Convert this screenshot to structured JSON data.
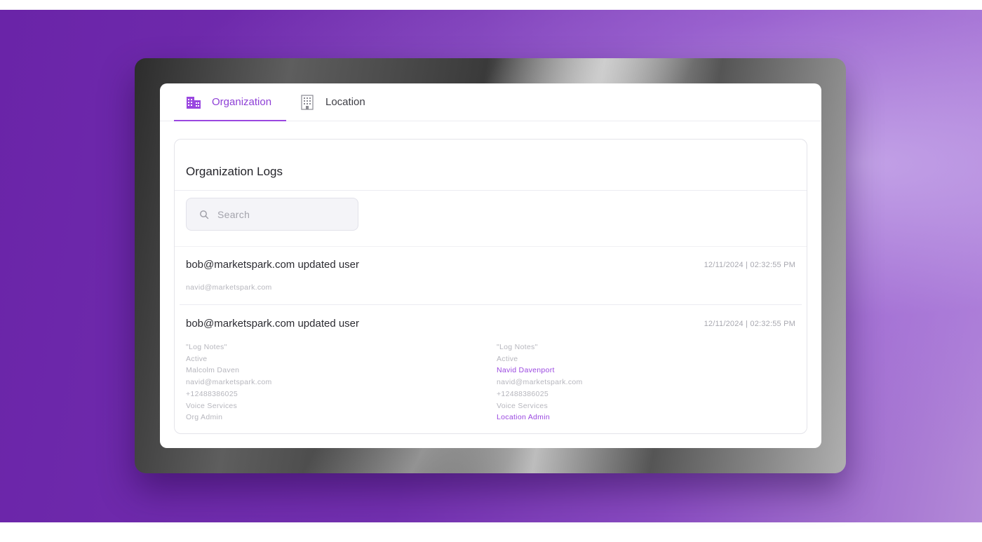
{
  "tabs": {
    "organization": {
      "label": "Organization",
      "icon": "building-icon",
      "active": true
    },
    "location": {
      "label": "Location",
      "icon": "office-building-icon",
      "active": false
    }
  },
  "logs": {
    "title": "Organization Logs",
    "search": {
      "placeholder": "Search",
      "value": ""
    },
    "entries": [
      {
        "title": "bob@marketspark.com updated user",
        "timestamp": "12/11/2024 | 02:32:55 PM",
        "subtitle": "navid@marketspark.com"
      },
      {
        "title": "bob@marketspark.com updated user",
        "timestamp": "12/11/2024 | 02:32:55 PM",
        "before": [
          "\"Log Notes\"",
          "Active",
          "Malcolm Daven",
          "navid@marketspark.com",
          "+12488386025",
          "Voice Services",
          "Org Admin"
        ],
        "after": [
          "\"Log Notes\"",
          "Active",
          "Navid Davenport",
          "navid@marketspark.com",
          "+12488386025",
          "Voice Services",
          "Location Admin"
        ]
      }
    ]
  },
  "colors": {
    "accent": "#9a47e0",
    "background_purple": "#6a24a8",
    "text_primary": "#2b2b31",
    "text_muted": "#b6b6bd"
  }
}
